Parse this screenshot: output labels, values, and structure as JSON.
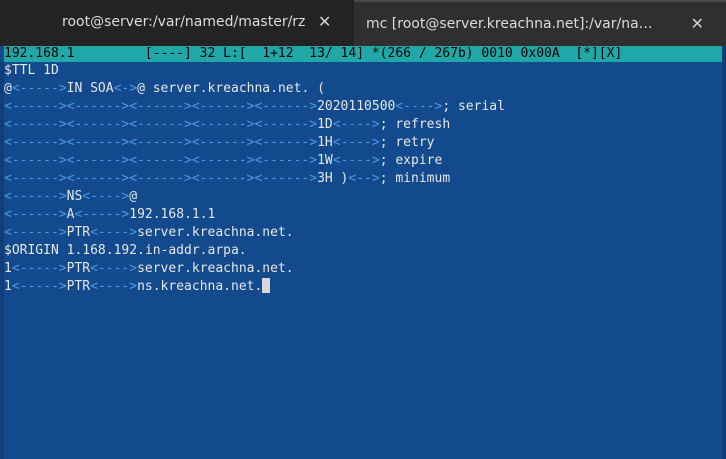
{
  "tabs": [
    {
      "title": "root@server:/var/named/master/rz",
      "close": "✕"
    },
    {
      "title": "mc [root@server.kreachna.net]:/var/na…",
      "close": "✕"
    }
  ],
  "status_line": "192.168.1         [----] 32 L:[  1+12  13/ 14] *(266 / 267b) 0010 0x00A  [*][X]",
  "lines": [
    [
      {
        "t": "$TTL 1D"
      }
    ],
    [
      {
        "t": "@"
      },
      {
        "t": "<----->",
        "tab": true
      },
      {
        "t": "IN SOA"
      },
      {
        "t": "<->",
        "tab": true
      },
      {
        "t": "@ server.kreachna.net. ("
      }
    ],
    [
      {
        "t": "<------><------><------><------><------>",
        "tab": true
      },
      {
        "t": "2020110500"
      },
      {
        "t": "<---->",
        "tab": true
      },
      {
        "t": "; serial"
      }
    ],
    [
      {
        "t": "<------><------><------><------><------>",
        "tab": true
      },
      {
        "t": "1D"
      },
      {
        "t": "<---->",
        "tab": true
      },
      {
        "t": "; refresh"
      }
    ],
    [
      {
        "t": "<------><------><------><------><------>",
        "tab": true
      },
      {
        "t": "1H"
      },
      {
        "t": "<---->",
        "tab": true
      },
      {
        "t": "; retry"
      }
    ],
    [
      {
        "t": "<------><------><------><------><------>",
        "tab": true
      },
      {
        "t": "1W"
      },
      {
        "t": "<---->",
        "tab": true
      },
      {
        "t": "; expire"
      }
    ],
    [
      {
        "t": "<------><------><------><------><------>",
        "tab": true
      },
      {
        "t": "3H )"
      },
      {
        "t": "<-->",
        "tab": true
      },
      {
        "t": "; minimum"
      }
    ],
    [
      {
        "t": "<------>",
        "tab": true
      },
      {
        "t": "NS"
      },
      {
        "t": "<---->",
        "tab": true
      },
      {
        "t": "@"
      }
    ],
    [
      {
        "t": "<------>",
        "tab": true
      },
      {
        "t": "A"
      },
      {
        "t": "<----->",
        "tab": true
      },
      {
        "t": "192.168.1.1"
      }
    ],
    [
      {
        "t": "<------>",
        "tab": true
      },
      {
        "t": "PTR"
      },
      {
        "t": "<---->",
        "tab": true
      },
      {
        "t": "server.kreachna.net."
      }
    ],
    [
      {
        "t": "$ORIGIN 1.168.192.in-addr.arpa."
      }
    ],
    [
      {
        "t": "1"
      },
      {
        "t": "<----->",
        "tab": true
      },
      {
        "t": "PTR"
      },
      {
        "t": "<---->",
        "tab": true
      },
      {
        "t": "server.kreachna.net."
      }
    ],
    [
      {
        "t": "1"
      },
      {
        "t": "<----->",
        "tab": true
      },
      {
        "t": "PTR"
      },
      {
        "t": "<---->",
        "tab": true
      },
      {
        "t": "ns.kreachna.net."
      }
    ]
  ]
}
